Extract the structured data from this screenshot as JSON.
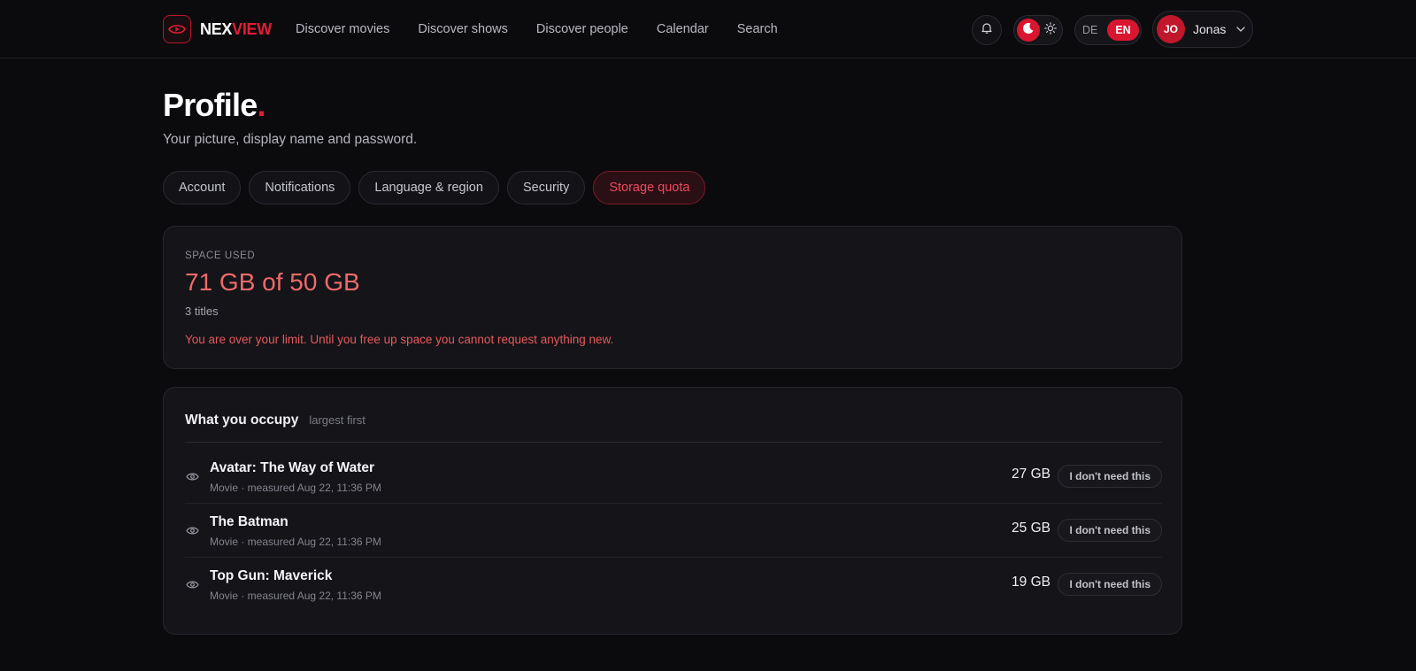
{
  "brand": {
    "part1": "NEX",
    "part2": "VIEW",
    "accent": "#e11d34"
  },
  "nav": {
    "items": [
      {
        "label": "Discover movies"
      },
      {
        "label": "Discover shows"
      },
      {
        "label": "Discover people"
      },
      {
        "label": "Calendar"
      },
      {
        "label": "Search"
      }
    ]
  },
  "header": {
    "bell_icon": "bell-icon",
    "theme": {
      "selected": "dark",
      "icons": [
        "moon-icon",
        "sun-icon"
      ]
    },
    "language": {
      "options": [
        "DE",
        "EN"
      ],
      "selected": "EN"
    },
    "user": {
      "initials": "JO",
      "name": "Jonas"
    }
  },
  "page": {
    "title": "Profile",
    "title_dot": ".",
    "subtitle": "Your picture, display name and password."
  },
  "tabs": [
    {
      "label": "Account",
      "active": false
    },
    {
      "label": "Notifications",
      "active": false
    },
    {
      "label": "Language & region",
      "active": false
    },
    {
      "label": "Security",
      "active": false
    },
    {
      "label": "Storage quota",
      "active": true
    }
  ],
  "usage": {
    "label": "SPACE USED",
    "value": "71 GB of 50 GB",
    "count": "3 titles",
    "warning": "You are over your limit. Until you free up space you cannot request anything new.",
    "warning_color": "#e65a5a"
  },
  "occupancy": {
    "title": "What you occupy",
    "hint": "largest first",
    "items": [
      {
        "title": "Avatar: The Way of Water",
        "meta": "Movie · measured Aug 22, 11:36 PM",
        "size": "27 GB",
        "action": "I don't need this"
      },
      {
        "title": "The Batman",
        "meta": "Movie · measured Aug 22, 11:36 PM",
        "size": "25 GB",
        "action": "I don't need this"
      },
      {
        "title": "Top Gun: Maverick",
        "meta": "Movie · measured Aug 22, 11:36 PM",
        "size": "19 GB",
        "action": "I don't need this"
      }
    ]
  }
}
